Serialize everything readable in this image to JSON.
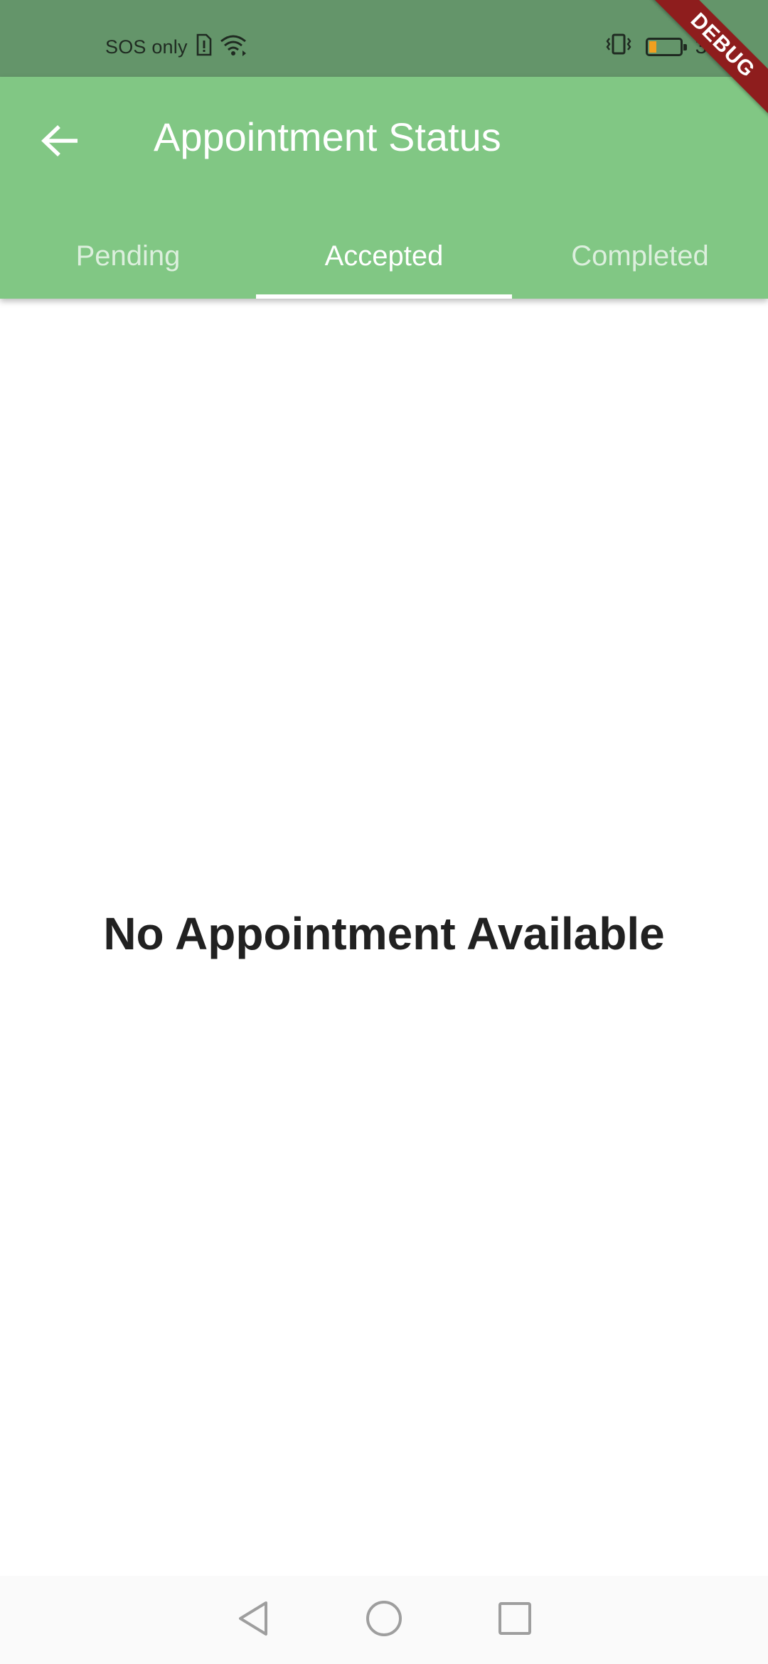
{
  "status_bar": {
    "carrier": "SOS only",
    "sim_icon": "sim-alert-icon",
    "wifi_icon": "wifi-icon",
    "vibrate_icon": "vibrate-icon",
    "battery_icon": "battery-low-icon",
    "battery_color": "#f0a020",
    "time": "3:44"
  },
  "app_bar": {
    "back_icon": "arrow-back-icon",
    "title": "Appointment Status",
    "background": "#81c784"
  },
  "tabs": [
    {
      "label": "Pending",
      "active": false
    },
    {
      "label": "Accepted",
      "active": true
    },
    {
      "label": "Completed",
      "active": false
    }
  ],
  "main": {
    "empty_message": "No Appointment Available"
  },
  "debug_banner": {
    "label": "DEBUG"
  },
  "nav_bar": {
    "back_icon": "nav-back-triangle-icon",
    "home_icon": "nav-home-circle-icon",
    "recents_icon": "nav-recents-square-icon"
  }
}
